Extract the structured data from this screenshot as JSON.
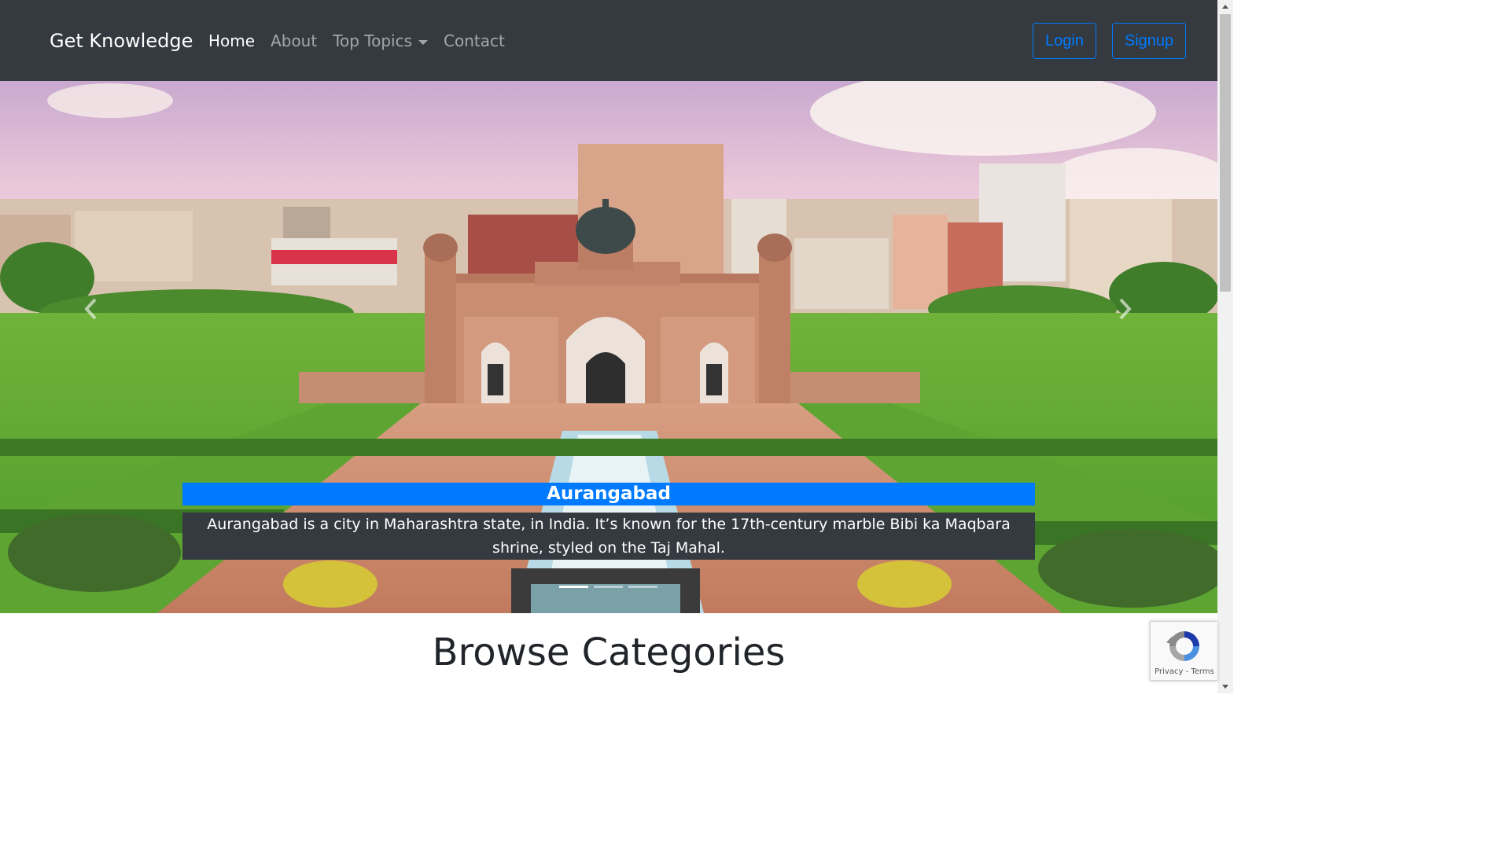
{
  "navbar": {
    "brand": "Get Knowledge",
    "links": [
      {
        "label": "Home",
        "active": true
      },
      {
        "label": "About",
        "active": false
      },
      {
        "label": "Top Topics",
        "active": false
      },
      {
        "label": "Contact",
        "active": false
      }
    ],
    "login_label": "Login",
    "signup_label": "Signup"
  },
  "carousel": {
    "slide_title": "Aurangabad",
    "slide_text": "Aurangabad is a city in Maharashtra state, in India. It’s known for the 17th-century marble Bibi ka Maqbara shrine, styled on the Taj Mahal.",
    "slide_count": 3,
    "active_index": 0,
    "prev_icon": "chevron-left-icon",
    "next_icon": "chevron-right-icon"
  },
  "main": {
    "heading": "Browse Categories"
  },
  "recaptcha": {
    "privacy_label": "Privacy",
    "separator": " - ",
    "terms_label": "Terms"
  },
  "colors": {
    "navbar_bg": "#343a40",
    "primary": "#007bff",
    "caption_bg": "#343a40"
  }
}
